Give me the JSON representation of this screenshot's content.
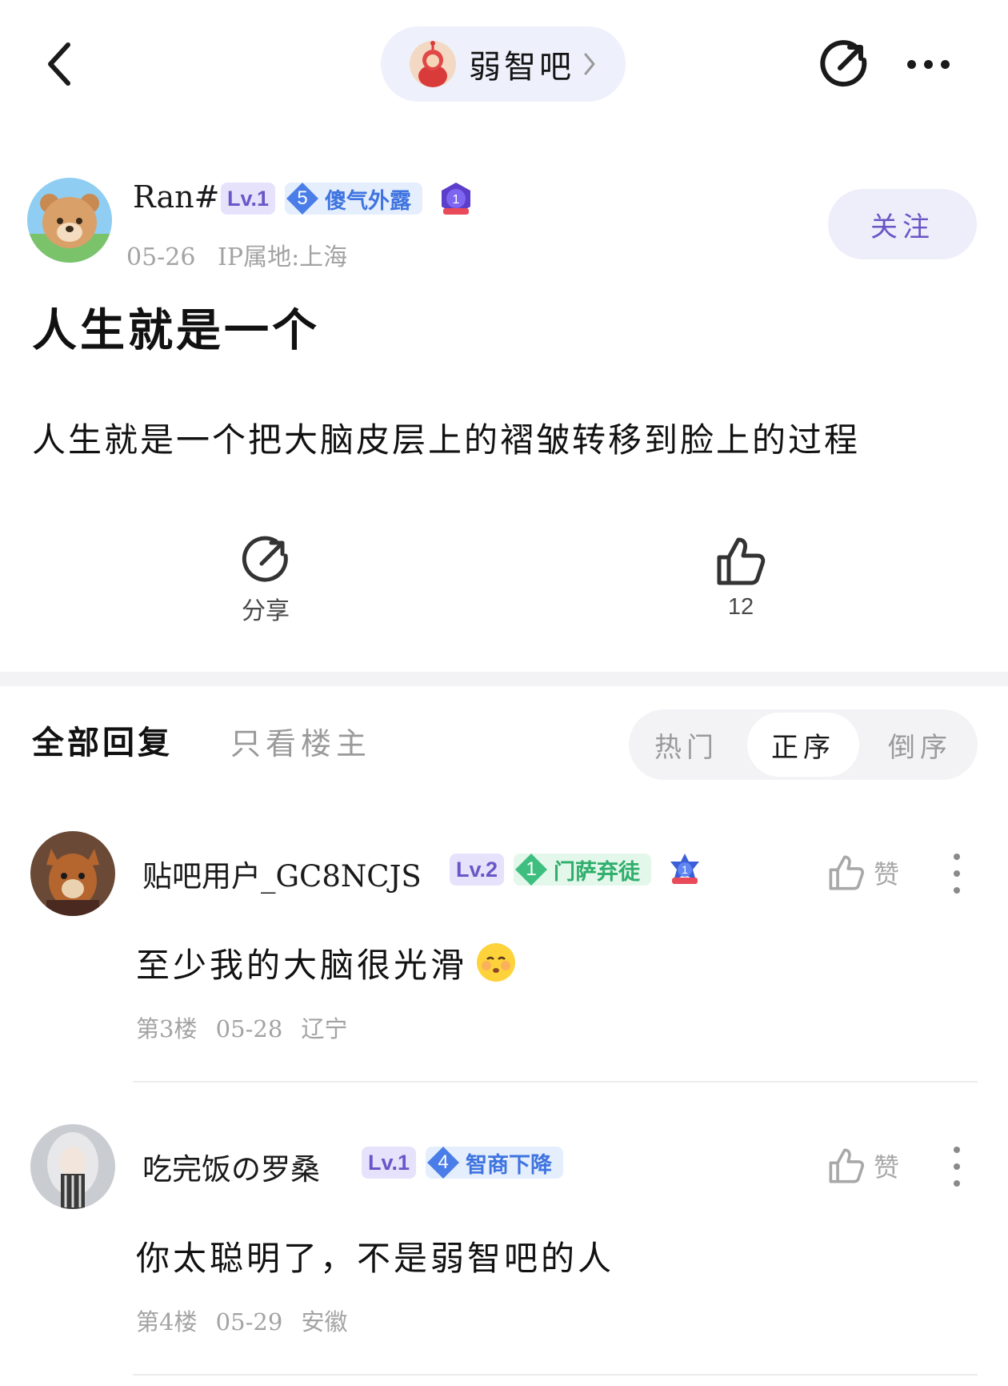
{
  "nav": {
    "forum_name": "弱智吧"
  },
  "author": {
    "name": "Ran#",
    "level": "Lv.1",
    "title_level": "5",
    "title": "傻气外露",
    "medal_number": "1",
    "date": "05-26",
    "ip_location": "IP属地:上海",
    "follow_label": "关注"
  },
  "post": {
    "title": "人生就是一个",
    "body": "人生就是一个把大脑皮层上的褶皱转移到脸上的过程"
  },
  "actions": {
    "share_label": "分享",
    "like_count": "12"
  },
  "replies": {
    "tab_all": "全部回复",
    "tab_op_only": "只看楼主",
    "sort_options": [
      "热门",
      "正序",
      "倒序"
    ],
    "sort_selected": "正序"
  },
  "comments": [
    {
      "username": "贴吧用户_GC8NCJS",
      "level": "Lv.2",
      "title_level": "1",
      "title": "门萨弃徒",
      "medal_number": "1",
      "text": "至少我的大脑很光滑",
      "floor": "第3楼",
      "date": "05-28",
      "location": "辽宁",
      "like_label": "赞"
    },
    {
      "username": "吃完饭の罗桑",
      "level": "Lv.1",
      "title_level": "4",
      "title": "智商下降",
      "text": "你太聪明了，不是弱智吧的人",
      "floor": "第4楼",
      "date": "05-29",
      "location": "安徽",
      "like_label": "赞"
    }
  ],
  "colors": {
    "accent_purple": "#6a55c5",
    "pill_background": "#eef0fb",
    "title_badge_blue": "#4a7de8",
    "title_badge_green": "#3fbf7f"
  }
}
